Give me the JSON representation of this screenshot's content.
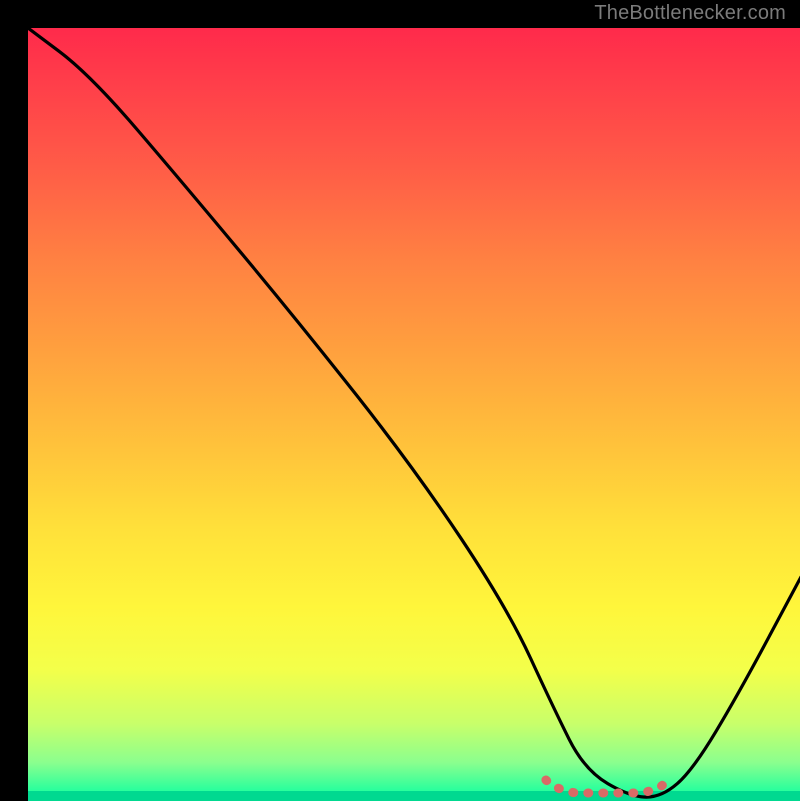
{
  "watermark": "TheBottlenecker.com",
  "colors": {
    "frame": "#000000",
    "curve": "#000000",
    "dots": "#d96a66"
  },
  "chart_data": {
    "type": "line",
    "title": "",
    "xlabel": "",
    "ylabel": "",
    "xlim": [
      0,
      100
    ],
    "ylim": [
      0,
      100
    ],
    "grid": false,
    "legend": false,
    "series": [
      {
        "name": "bottleneck-curve",
        "x": [
          0,
          8,
          20,
          35,
          50,
          62,
          68,
          72,
          78,
          82,
          86,
          92,
          100
        ],
        "y": [
          100,
          94,
          80,
          62,
          43,
          25,
          12,
          4,
          0.5,
          0.5,
          4,
          14,
          29
        ]
      }
    ],
    "highlight_segment": {
      "name": "optimal-range-dots",
      "x_start": 67,
      "x_end": 83,
      "note": "dotted marker band near valley floor"
    },
    "gradient_stops": [
      {
        "pos": 0.0,
        "hex": "#ff2a4b"
      },
      {
        "pos": 0.3,
        "hex": "#ff8142"
      },
      {
        "pos": 0.65,
        "hex": "#ffe13a"
      },
      {
        "pos": 0.9,
        "hex": "#c8ff6a"
      },
      {
        "pos": 1.0,
        "hex": "#00e690"
      }
    ]
  }
}
